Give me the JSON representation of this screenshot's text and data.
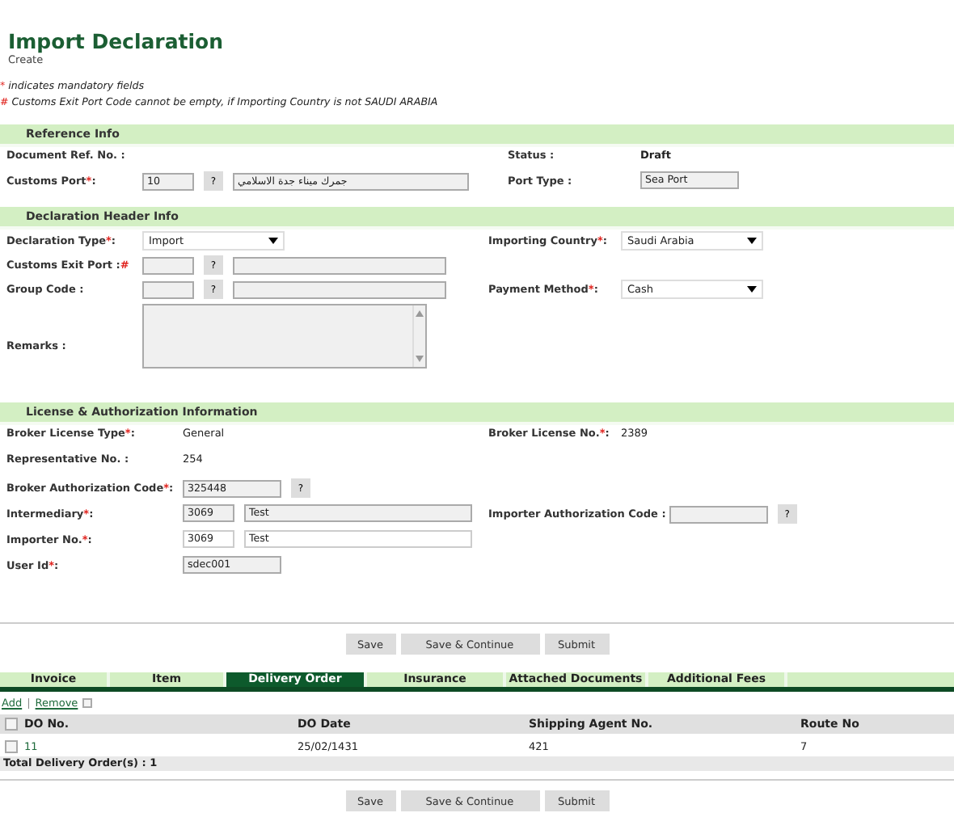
{
  "header": {
    "title": "Import Declaration",
    "subtitle": "Create"
  },
  "notes": [
    {
      "mark": "*",
      "text": "indicates mandatory fields"
    },
    {
      "mark": "#",
      "text": "Customs Exit Port Code cannot be empty, if Importing Country is not SAUDI ARABIA"
    }
  ],
  "sections": [
    {
      "title": "Reference Info",
      "rows": [
        {
          "left": {
            "label": [
              {
                "kind": "text",
                "text": "Document Ref. No. :"
              }
            ]
          },
          "right": {
            "label": [
              {
                "kind": "text",
                "text": "Status :"
              }
            ],
            "controls": [
              {
                "kind": "bold",
                "text": "Draft"
              }
            ]
          }
        },
        {
          "left": {
            "label": [
              {
                "kind": "text",
                "text": "Customs Port"
              },
              {
                "kind": "mark",
                "text": "*"
              },
              {
                "kind": "text",
                "text": ":"
              }
            ],
            "controls": [
              {
                "kind": "input",
                "value": "10",
                "readonly": true
              },
              {
                "kind": "help",
                "text": "?"
              },
              {
                "kind": "input",
                "value": "جمرك ميناء جدة الاسلامي",
                "readonly": true
              }
            ]
          },
          "right": {
            "label": [
              {
                "kind": "text",
                "text": "Port Type :"
              }
            ],
            "controls": [
              {
                "kind": "input",
                "value": "Sea Port",
                "readonly": true
              }
            ]
          }
        }
      ]
    },
    {
      "title": "Declaration Header Info",
      "rows": [
        {
          "left": {
            "label": [
              {
                "kind": "text",
                "text": "Declaration Type"
              },
              {
                "kind": "mark",
                "text": "*"
              },
              {
                "kind": "text",
                "text": ":"
              }
            ],
            "controls": [
              {
                "kind": "select",
                "value": "Import"
              }
            ]
          },
          "right": {
            "label": [
              {
                "kind": "text",
                "text": "Importing Country"
              },
              {
                "kind": "mark",
                "text": "*"
              },
              {
                "kind": "text",
                "text": ":"
              }
            ],
            "controls": [
              {
                "kind": "select",
                "value": "Saudi Arabia"
              }
            ]
          }
        },
        {
          "left": {
            "label": [
              {
                "kind": "text",
                "text": "Customs Exit Port :"
              },
              {
                "kind": "mark",
                "text": "#"
              }
            ],
            "controls": [
              {
                "kind": "input",
                "readonly": true
              },
              {
                "kind": "help",
                "text": "?"
              },
              {
                "kind": "input",
                "readonly": true
              }
            ]
          }
        },
        {
          "left": {
            "label": [
              {
                "kind": "text",
                "text": "Group Code :"
              }
            ],
            "controls": [
              {
                "kind": "input",
                "readonly": true
              },
              {
                "kind": "help",
                "text": "?"
              },
              {
                "kind": "input",
                "readonly": true
              }
            ]
          },
          "right": {
            "label": [
              {
                "kind": "text",
                "text": "Payment Method"
              },
              {
                "kind": "mark",
                "text": "*"
              },
              {
                "kind": "text",
                "text": ":"
              }
            ],
            "controls": [
              {
                "kind": "select",
                "value": "Cash"
              }
            ]
          }
        },
        {
          "left": {
            "label": [
              {
                "kind": "text",
                "text": "Remarks :"
              }
            ],
            "controls": [
              {
                "kind": "textarea"
              }
            ]
          }
        }
      ]
    },
    {
      "title": "License & Authorization Information",
      "rows": [
        {
          "left": {
            "label": [
              {
                "kind": "text",
                "text": "Broker License Type"
              },
              {
                "kind": "mark",
                "text": "*"
              },
              {
                "kind": "text",
                "text": ":"
              }
            ],
            "controls": [
              {
                "kind": "plain",
                "text": "General"
              }
            ]
          },
          "right": {
            "label": [
              {
                "kind": "text",
                "text": "Broker License No."
              },
              {
                "kind": "mark",
                "text": "*"
              },
              {
                "kind": "text",
                "text": ":"
              }
            ],
            "controls": [
              {
                "kind": "plain",
                "text": "2389"
              }
            ]
          }
        },
        {
          "left": {
            "label": [
              {
                "kind": "text",
                "text": "Representative No. :"
              }
            ],
            "controls": [
              {
                "kind": "plain",
                "text": "254"
              }
            ]
          }
        },
        {
          "left": {
            "label": [
              {
                "kind": "text",
                "text": "Broker Authorization Code"
              },
              {
                "kind": "mark",
                "text": "*"
              },
              {
                "kind": "text",
                "text": ":"
              }
            ],
            "controls": [
              {
                "kind": "input",
                "value": "325448",
                "readonly": true
              },
              {
                "kind": "help",
                "text": "?"
              }
            ]
          }
        },
        {
          "left": {
            "label": [
              {
                "kind": "text",
                "text": "Intermediary"
              },
              {
                "kind": "mark",
                "text": "*"
              },
              {
                "kind": "text",
                "text": ":"
              }
            ],
            "controls": [
              {
                "kind": "input",
                "value": "3069",
                "readonly": true
              },
              {
                "kind": "input",
                "value": "Test",
                "readonly": true
              }
            ]
          },
          "right": {
            "label": [
              {
                "kind": "text",
                "text": "Importer Authorization Code :"
              }
            ],
            "controls": [
              {
                "kind": "input",
                "readonly": true
              },
              {
                "kind": "help",
                "text": "?"
              }
            ]
          }
        },
        {
          "left": {
            "label": [
              {
                "kind": "text",
                "text": "Importer No."
              },
              {
                "kind": "mark",
                "text": "*"
              },
              {
                "kind": "text",
                "text": ":"
              }
            ],
            "controls": [
              {
                "kind": "input",
                "value": "3069",
                "readonly": false
              },
              {
                "kind": "input",
                "value": "Test",
                "readonly": false
              }
            ]
          }
        },
        {
          "left": {
            "label": [
              {
                "kind": "text",
                "text": "User Id"
              },
              {
                "kind": "mark",
                "text": "*"
              },
              {
                "kind": "text",
                "text": ":"
              }
            ],
            "controls": [
              {
                "kind": "input",
                "value": "sdec001",
                "readonly": true
              }
            ]
          }
        }
      ]
    }
  ],
  "actions_top": [
    "Save",
    "Save & Continue",
    "Submit"
  ],
  "tabs": [
    {
      "label": "Invoice",
      "selected": false
    },
    {
      "label": "Item",
      "selected": false
    },
    {
      "label": "Delivery Order",
      "selected": true
    },
    {
      "label": "Insurance",
      "selected": false
    },
    {
      "label": "Attached Documents",
      "selected": false
    },
    {
      "label": "Additional Fees",
      "selected": false
    }
  ],
  "list_actions": {
    "add": "Add",
    "separator": "|",
    "remove": "Remove",
    "checked": false
  },
  "table": {
    "all_checked": false,
    "columns": [
      "DO No.",
      "DO Date",
      "Shipping Agent No.",
      "Route No"
    ],
    "rows": [
      {
        "checked": false,
        "cells": [
          "11",
          "25/02/1431",
          "421",
          "7"
        ]
      }
    ],
    "total": "Total Delivery Order(s) : 1"
  },
  "actions_bottom": [
    "Save",
    "Save & Continue",
    "Submit"
  ]
}
